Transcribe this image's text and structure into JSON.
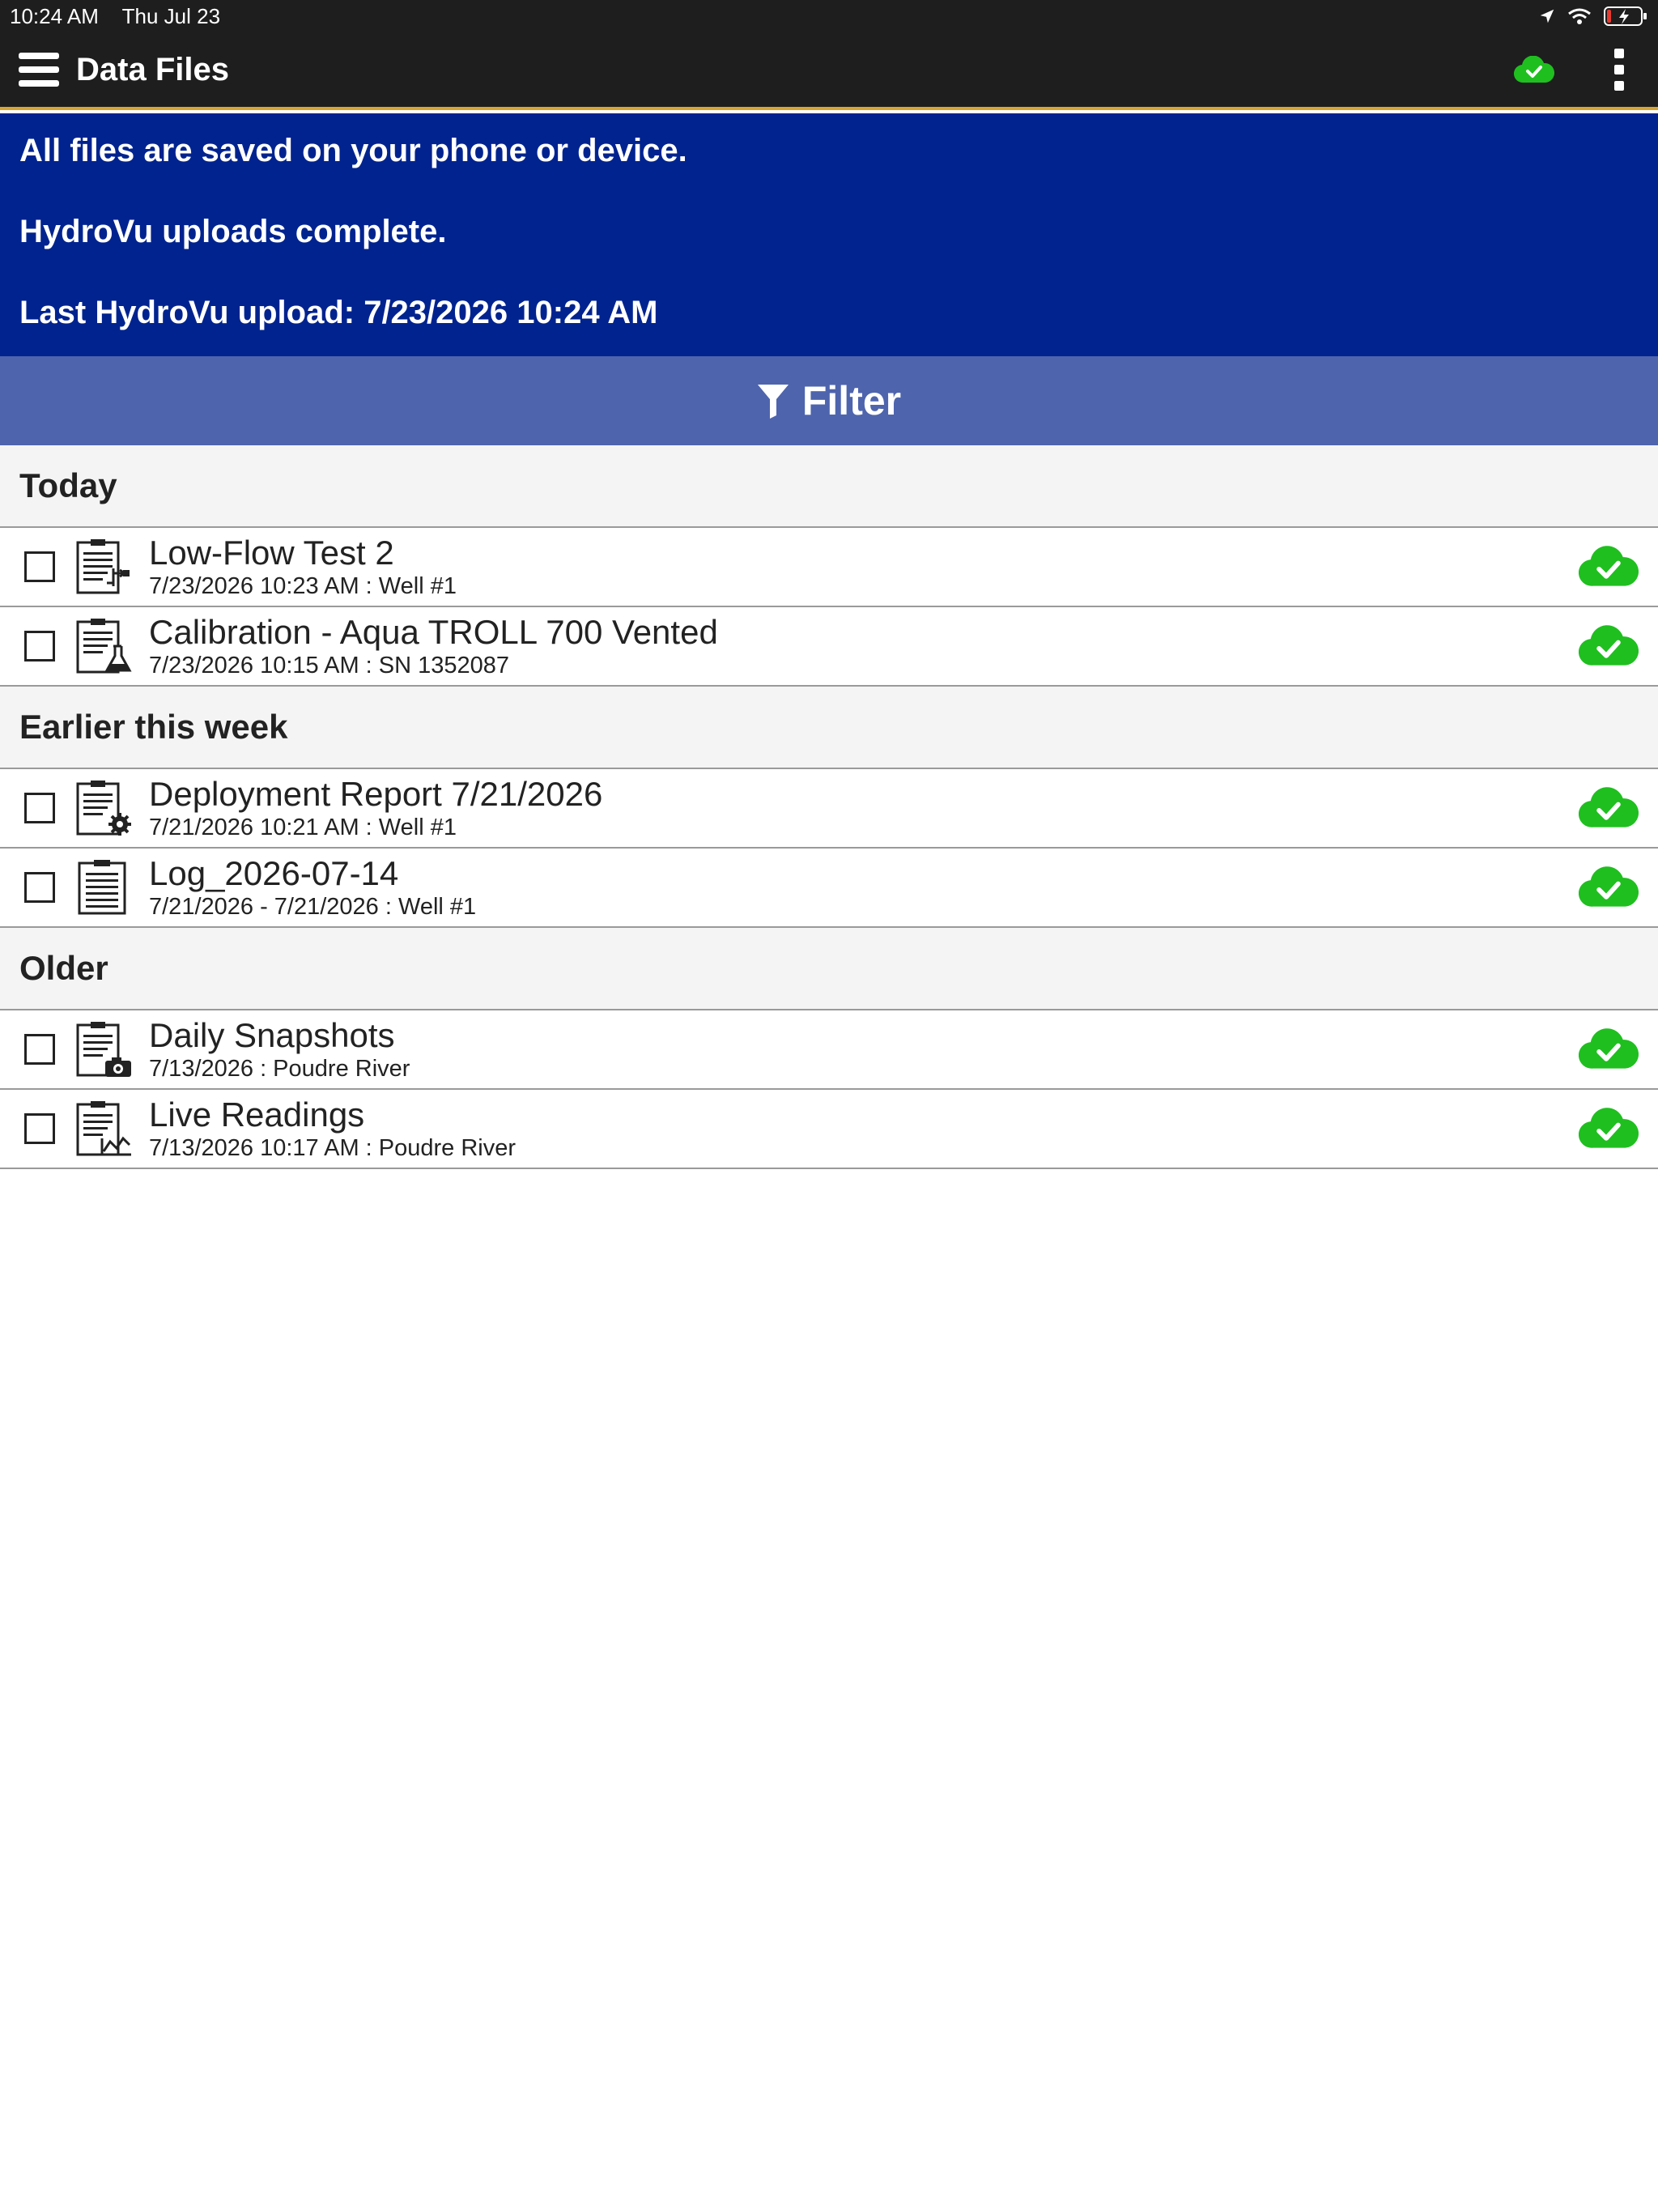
{
  "status_bar": {
    "time": "10:24 AM",
    "date": "Thu Jul 23"
  },
  "app_bar": {
    "title": "Data Files",
    "sync_icon": "cloud-check-icon",
    "menu_icon": "hamburger-menu-icon",
    "more_icon": "vertical-ellipsis-icon"
  },
  "info": {
    "line1": "All files are saved on your phone or device.",
    "line2": "HydroVu uploads complete.",
    "line3": "Last HydroVu upload: 7/23/2026 10:24 AM"
  },
  "filter": {
    "label": "Filter",
    "icon": "funnel-icon"
  },
  "sections": [
    {
      "label": "Today",
      "files": [
        {
          "title": "Low-Flow Test 2",
          "subtitle": "7/23/2026 10:23 AM : Well #1",
          "icon": "lowflow-report-icon"
        },
        {
          "title": "Calibration - Aqua TROLL 700 Vented",
          "subtitle": "7/23/2026 10:15 AM : SN 1352087",
          "icon": "calibration-report-icon"
        }
      ]
    },
    {
      "label": "Earlier this week",
      "files": [
        {
          "title": "Deployment Report 7/21/2026",
          "subtitle": "7/21/2026 10:21 AM : Well #1",
          "icon": "deployment-report-icon"
        },
        {
          "title": "Log_2026-07-14",
          "subtitle": "7/21/2026 - 7/21/2026 : Well #1",
          "icon": "log-file-icon"
        }
      ]
    },
    {
      "label": "Older",
      "files": [
        {
          "title": "Daily Snapshots",
          "subtitle": "7/13/2026 : Poudre River",
          "icon": "snapshot-report-icon"
        },
        {
          "title": "Live Readings",
          "subtitle": "7/13/2026 10:17 AM : Poudre River",
          "icon": "live-readings-icon"
        }
      ]
    }
  ],
  "colors": {
    "app_bar": "#1e1e1e",
    "accent_line": "#d8a630",
    "banner": "#00238f",
    "filter_bar": "#4e64ad",
    "sync_green": "#1fbf1f"
  }
}
